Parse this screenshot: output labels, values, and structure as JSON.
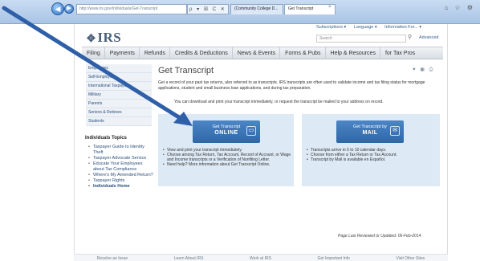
{
  "browser": {
    "back_label": "◀",
    "forward_label": "▶",
    "address": "http://www.irs.gov/Individuals/Get-Transcript",
    "address_tools": "ρ ▾ ☒ C ✕",
    "tabs": [
      {
        "label": "(Community College D..."
      },
      {
        "label": "Get Transcript"
      }
    ],
    "tab_close": "×",
    "window_icons": "⌂ ☆ ⚙"
  },
  "header": {
    "logo_text": "IRS",
    "logo_icon": "eagle-icon",
    "util_links": [
      "Subscriptions ▾",
      "Language ▾",
      "Information For... ▾"
    ],
    "search_placeholder": "Search",
    "advanced_label": "Advanced"
  },
  "mainnav": {
    "items": [
      "Filing",
      "Payments",
      "Refunds",
      "Credits & Deductions",
      "News & Events",
      "Forms & Pubs",
      "Help & Resources",
      "for Tax Pros"
    ]
  },
  "sidebar": {
    "items": [
      "Employees",
      "Self-Employed",
      "International Taxpayers",
      "Military",
      "Parents",
      "Seniors & Retirees",
      "Students"
    ],
    "topics_title": "Individuals Topics",
    "topics": [
      "Taxpayer Guide to Identity Theft",
      "Taxpayer Advocate Service",
      "Educate Your Employees about Tax Compliance",
      "Where's My Amended Return?",
      "Taxpayer Rights",
      "Individuals Home"
    ]
  },
  "main": {
    "title": "Get Transcript",
    "title_icons": "♥ ▣ ⎙",
    "intro": "Get a record of your past tax returns, also referred to as transcripts. IRS transcripts are often used to validate income and tax filing status for mortgage applications, student and small business loan applications, and during tax preparation.",
    "intro2": "You can download and print your transcript immediately, or request the transcript be mailed to your address on record.",
    "online": {
      "button_line1": "Get Transcript",
      "button_line2": "ONLINE",
      "bullets": [
        "View and print your transcript immediately.",
        "Choose among Tax Return, Tax Account, Record of Account, or Wage and Income transcripts or a Verification of Nonfiling Letter.",
        "Need help? More information about Get Transcript Online."
      ]
    },
    "mail": {
      "button_line1": "Get Transcript by",
      "button_line2": "MAIL",
      "bullets": [
        "Transcripts arrive in 5 to 10 calendar days.",
        "Choose from either a Tax Return or Tax Account.",
        "Transcript by Mail is available en Español."
      ]
    },
    "reviewed": "Page Last Reviewed or Updated: 06-Feb-2014"
  },
  "footer": {
    "items": [
      "Resolve an Issue",
      "Learn About IRS",
      "Work at IRS",
      "Get Important Info",
      "Visit Other Sites"
    ]
  },
  "colors": {
    "arrow": "#2e5fa8",
    "cta": "#2f66a6",
    "panel": "#dde9f5"
  }
}
